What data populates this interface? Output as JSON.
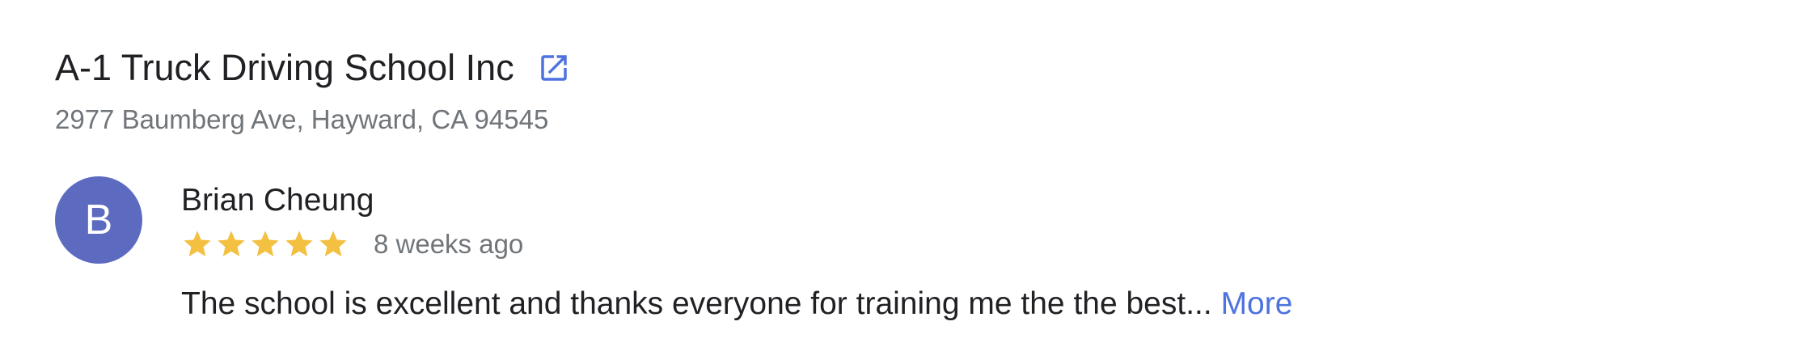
{
  "business": {
    "name": "A-1 Truck Driving School Inc",
    "address": "2977 Baumberg Ave, Hayward, CA 94545",
    "link_icon": "external-link-icon"
  },
  "review": {
    "avatar_initial": "B",
    "reviewer_name": "Brian Cheung",
    "rating": 5,
    "rating_max": 5,
    "age": "8 weeks ago",
    "text": "The school is excellent and thanks everyone for training me the the best...",
    "more_label": "More"
  },
  "colors": {
    "avatar": "#5c6bc0",
    "star": "#f4c042",
    "link": "#4e73df",
    "secondary_text": "#70757a"
  }
}
